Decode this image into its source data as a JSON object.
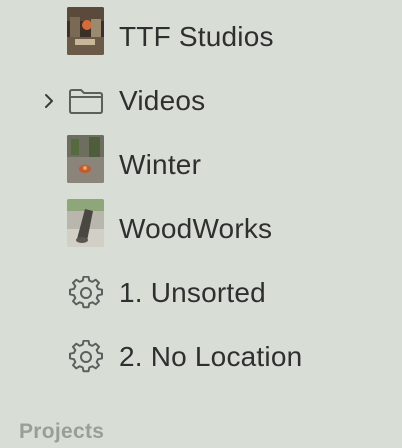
{
  "sidebar": {
    "items": [
      {
        "label": "TTF Studios",
        "icon": "album-thumbnail-icon",
        "expandable": false
      },
      {
        "label": "Videos",
        "icon": "folder-icon",
        "expandable": true
      },
      {
        "label": "Winter",
        "icon": "album-thumbnail-icon",
        "expandable": false
      },
      {
        "label": "WoodWorks",
        "icon": "album-thumbnail-icon",
        "expandable": false
      },
      {
        "label": "1. Unsorted",
        "icon": "gear-icon",
        "expandable": false
      },
      {
        "label": "2. No Location",
        "icon": "gear-icon",
        "expandable": false
      }
    ],
    "section_title": "Projects"
  },
  "colors": {
    "background": "#d8ddd6",
    "text": "#2e302f",
    "section_text": "#9a9e99",
    "icon_stroke": "#5c605d"
  }
}
